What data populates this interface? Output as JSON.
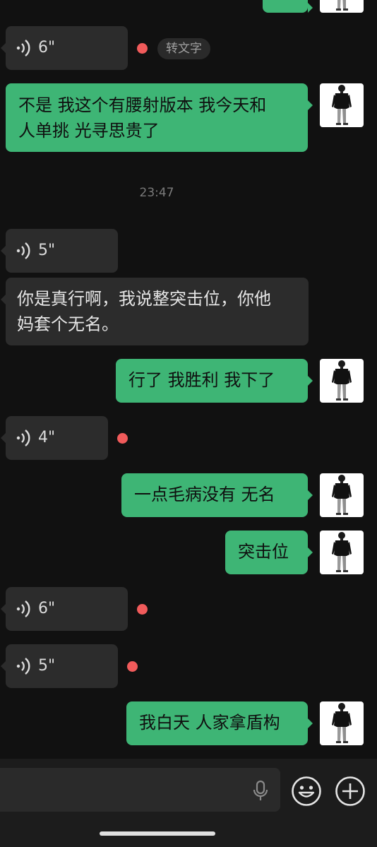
{
  "messages": {
    "voice_1": {
      "duration": "6\"",
      "convert_label": "转文字"
    },
    "text_1": {
      "line1": "不是  我这个有腰射版本  我今天和",
      "line2": "人单挑 光寻思贵了"
    },
    "timestamp": "23:47",
    "voice_2": {
      "duration": "5\""
    },
    "text_2": {
      "line1": "你是真行啊，我说整突击位，你他",
      "line2": "妈套个无名。"
    },
    "text_3": "行了 我胜利  我下了",
    "voice_3": {
      "duration": "4\""
    },
    "text_4": "一点毛病没有  无名",
    "text_5": "突击位",
    "voice_4": {
      "duration": "6\""
    },
    "voice_5": {
      "duration": "5\""
    },
    "text_6": "我白天 人家拿盾构"
  },
  "icons": {
    "voice_wave": "voice-wave-icon",
    "microphone": "microphone-icon",
    "emoji": "emoji-icon",
    "plus": "plus-icon"
  },
  "colors": {
    "background": "#111111",
    "incoming_bubble": "#2c2c2c",
    "outgoing_bubble": "#3eb575",
    "unread_dot": "#f15b5b"
  }
}
